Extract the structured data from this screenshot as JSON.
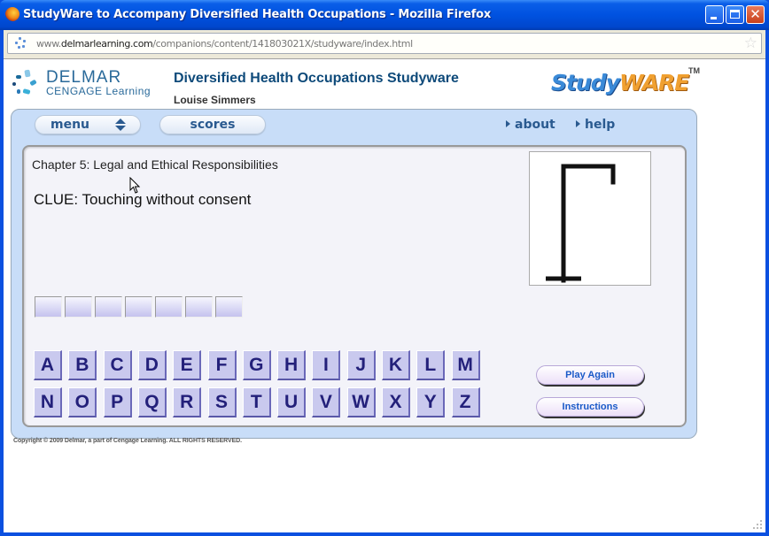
{
  "window": {
    "title": "StudyWare to Accompany Diversified Health Occupations - Mozilla Firefox",
    "controls": {
      "minimize": "minimize",
      "maximize": "maximize",
      "close": "✕"
    }
  },
  "urlbar": {
    "prefix": "www.",
    "domain": "delmarlearning.com",
    "path": "/companions/content/141803021X/studyware/index.html",
    "bookmark_icon": "☆"
  },
  "header": {
    "publisher_name": "DELMAR",
    "publisher_sub": "CENGAGE Learning",
    "app_title": "Diversified Health Occupations Studyware",
    "author": "Louise Simmers",
    "logo_part1": "Study",
    "logo_part2": "WARE",
    "logo_tm": "TM"
  },
  "nav": {
    "menu_label": "menu",
    "scores_label": "scores",
    "about_label": "about",
    "help_label": "help"
  },
  "game": {
    "chapter": "Chapter 5: Legal and Ethical Responsibilities",
    "clue": "CLUE: Touching without consent",
    "word_slots": [
      "",
      "",
      "",
      "",
      "",
      "",
      ""
    ],
    "hangman_stage": "gallows-only",
    "letters_row1": [
      "A",
      "B",
      "C",
      "D",
      "E",
      "F",
      "G",
      "H",
      "I",
      "J",
      "K",
      "L",
      "M"
    ],
    "letters_row2": [
      "N",
      "O",
      "P",
      "Q",
      "R",
      "S",
      "T",
      "U",
      "V",
      "W",
      "X",
      "Y",
      "Z"
    ],
    "play_again_label": "Play Again",
    "instructions_label": "Instructions"
  },
  "footer": {
    "copyright": "Copyright © 2009 Delmar, a part of Cengage Learning. ALL RIGHTS RESERVED."
  },
  "colors": {
    "titlebar": "#0052e0",
    "frame_bg": "#c8ddf8",
    "key_bg": "#c9c9ee",
    "key_text": "#23207a",
    "nav_text": "#2a5a90",
    "action_text": "#1a5ac8"
  }
}
